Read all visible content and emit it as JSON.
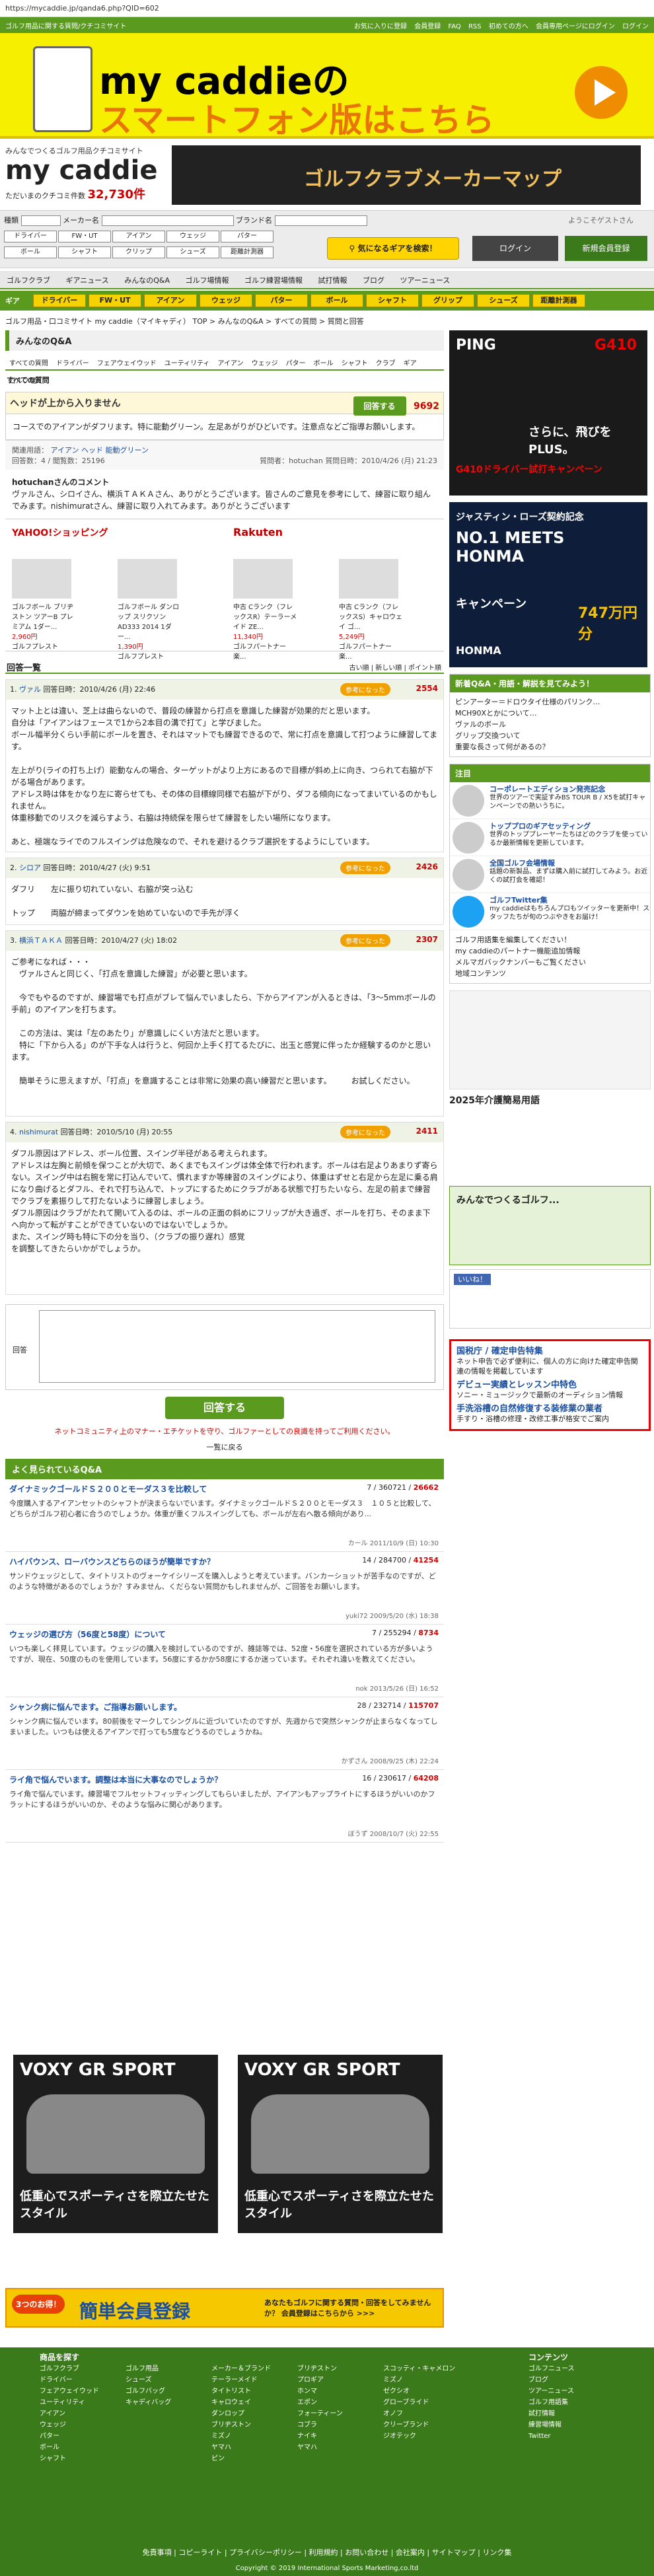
{
  "url": "https://mycaddie.jp/qanda6.php?QID=602",
  "top_strip": {
    "left": "ゴルフ用品に関する質問/クチコミサイト",
    "links": [
      "お気に入りに登録",
      "会員登録",
      "FAQ",
      "RSS",
      "初めての方へ",
      "会員専用ページにログイン",
      "ログイン"
    ]
  },
  "sp_banner": {
    "line1": "my caddieの",
    "line2": "スマートフォン版はこちら"
  },
  "logo": {
    "tagline": "みんなでつくるゴルフ用品クチコミサイト",
    "name": "my caddie",
    "count_label": "ただいまのクチコミ件数",
    "count": "32,730件"
  },
  "maker_banner": "ゴルフクラブメーカーマップ",
  "search": {
    "kind_label": "種類",
    "maker_label": "メーカー名",
    "brand_label": "ブランド名",
    "cats1": [
      "ドライバー",
      "FW・UT",
      "アイアン",
      "ウェッジ",
      "パター"
    ],
    "cats2": [
      "ボール",
      "シャフト",
      "クリップ",
      "シューズ",
      "距離計測器"
    ],
    "find_btn": "気になるギアを検索！",
    "login": "ログイン",
    "register": "新規会員登録",
    "welcome": "ようこそゲストさん"
  },
  "gnav": [
    "ゴルフクラブ",
    "ギアニュース",
    "みんなのQ&A",
    "ゴルフ場情報",
    "ゴルフ練習場情報",
    "試打情報",
    "ブログ",
    "ツアーニュース"
  ],
  "gear_nav": [
    "ギア",
    "ドライバー",
    "FW・UT",
    "アイアン",
    "ウェッジ",
    "パター",
    "ボール",
    "シャフト",
    "グリップ",
    "シューズ",
    "距離計測器"
  ],
  "breadcrumb": "ゴルフ用品・口コミサイト my caddie（マイキャディ） TOP > みんなのQ&A > すべての質問 > 質問と回答",
  "section_title": "みんなのQ&A",
  "tabs": [
    "すべての質問",
    "ドライバー",
    "フェアウェイウッド",
    "ユーティリティ",
    "アイアン",
    "ウェッジ",
    "パター",
    "ボール",
    "シャフト",
    "クラブ",
    "ギア",
    "ゴルフ場"
  ],
  "all_questions": "すべての質問",
  "question": {
    "title": "ヘッドが上から入りません",
    "answer_btn": "回答する",
    "score": "9692",
    "body": "コースでのアイアンがダフリます。特に能動グリーン。左足あがりがひどいです。注意点などご指導お願いします。",
    "genre_label": "関連用語：",
    "genres": [
      "アイアン",
      "ヘッド",
      "能動グリーン"
    ],
    "answers_label": "回答数：4",
    "views": "閲覧数：25196",
    "asker": "質問者：hotuchan",
    "date": "質問日時：2010/4/26 (月) 21:23"
  },
  "comment": {
    "title": "hotuchanさんのコメント",
    "body": "ヴァルさん、シロイさん、横浜ＴＡＫＡさん、ありがとうございます。皆さんのご意見を参考にして、練習に取り組んでみます。nishimuratさん、練習に取り入れてみます。ありがとうございます"
  },
  "shops": [
    {
      "shop": "YAHOO!ショッピング",
      "items": [
        {
          "name": "ゴルフボール ブリヂストン ツアーB プレミアム 1ダー...",
          "price": "2,960円",
          "store": "ゴルフプレスト"
        },
        {
          "name": "ゴルフボール ダンロップ スリクソン AD333 2014 1ダー...",
          "price": "1,390円",
          "store": "ゴルフプレスト"
        }
      ]
    },
    {
      "shop": "Rakuten",
      "items": [
        {
          "name": "中古 Cランク（フレックスR）テーラーメイド ZE...",
          "price": "11,340円",
          "store": "ゴルフパートナー 楽..."
        },
        {
          "name": "中古 Cランク（フレックスS）キャロウェイ ゴ...",
          "price": "5,249円",
          "store": "ゴルフパートナー 楽..."
        }
      ]
    }
  ],
  "answers_title": "回答一覧",
  "sort": "古い順 | 新しい順 | ポイント順",
  "answers": [
    {
      "num": "1.",
      "user": "ヴァル",
      "date": "回答日時：2010/4/26 (月) 22:46",
      "good": "参考になった",
      "score": "2554",
      "body": "マット上とは違い、芝上は曲らないので、普段の練習から打点を意識した練習が効果的だと思います。\n自分は「アイアンはフェースで1から2本目の溝で打て」と学びました。\nボール幅半分くらい手前にボールを置き、それはマットでも練習できるので、常に打点を意識して打つように練習してます。\n\n左上がり(ライの打ち上げ）能動なんの場合、ターゲットがより上方にあるので目標が斜め上に向き、つられて右脇が下がる場合があります。\nアドレス時は体をかなり左に寄らせても、その体の目標線同様で右脇が下がり、ダフる傾向になってまいているのかもしれません。\n体重移動でのリスクを減らすよう、右脇は持続保を限らせて練習をしたい場所になります。\n\nあと、極端なライでのフルスイングは危険なので、それを避けるクラブ選択をするようにしています。"
    },
    {
      "num": "2.",
      "user": "シロア",
      "date": "回答日時：2010/4/27 (火) 9:51",
      "good": "参考になった",
      "score": "2426",
      "body": "ダフリ　　左に振り切れていない、右脇が突っ込む\n\nトップ　　両脇が締まってダウンを始めていないので手先が浮く"
    },
    {
      "num": "3.",
      "user": "横浜ＴＡＫＡ",
      "date": "回答日時：2010/4/27 (火) 18:02",
      "good": "参考になった",
      "score": "2307",
      "body": "ご参考になれば・・・\n　ヴァルさんと同じく、「打点を意識した練習」が必要と思います。\n\n　今でもやるのですが、練習場でも打点がブレて悩んでいましたら、下からアイアンが入るときは、「3～5mmボールの手前」のアイアンを打ちます。\n\n　この方法は、実は「左のあたり」が意識しにくい方法だと思います。\n　特に「下から入る」のが下手な人は行うと、何回か上手く打てるたびに、出玉と感覚に伴ったか経験するのかと思います。\n\n　簡単そうに思えますが、「打点」を意識することは非常に効果の高い練習だと思います。　　　お試しください。"
    },
    {
      "num": "4.",
      "user": "nishimurat",
      "date": "回答日時：2010/5/10 (月) 20:55",
      "good": "参考になった",
      "score": "2411",
      "body": "ダフル原因はアドレス、ボール位置、スイング半径がある考えられます。\nアドレスは左胸と前傾を保つことが大切で、あくまでもスイングは体全体で行われます。ボールは右足よりあまりず寄らない。スイング中は右腕を常に打込んでいて、慣れますか等練習のスイングにより、体重はずせと右足から左足に乗る肩になり曲げるとダフル、それで打ち込んで、トップにするためにクラブがある状態で打ちたいなら、左足の前まで練習でクラブを素振りして打たないように練習しましょう。\nダフル原因はクラブがたれて開いて入るのは、ボールの正面の斜めにフリップが大き過ぎ、ボールを打ち、そのまま下へ向かって転がすことができていないのではないでしょうか。\nまた、スイング時も特に下の分を当り、（クラブの振り遅れ）感覚\nを調整してきたらいかがでしょうか。"
    }
  ],
  "reply": {
    "label": "回答",
    "submit": "回答する",
    "warn": "ネットコミュニティ上のマナー・エチケットを守り、ゴルファーとしての良識を持ってご利用ください。",
    "back": "一覧に戻る"
  },
  "related_title": "よく見られているQ&A",
  "related": [
    {
      "title": "ダイナミックゴールドＳ２００とモーダス３を比較して",
      "ans": "7",
      "views": "360721",
      "pts": "26662",
      "body": "今度購入するアイアンセットのシャフトが決まらないでいます。ダイナミックゴールドＳ２００とモーダス３　１０５と比較して、どちらがゴルフ初心者に合うのでしょうか。体重が重くフルスイングしても、ボールが左右へ散る傾向があり...",
      "foot": "カール 2011/10/9 (日) 10:30"
    },
    {
      "title": "ハイバウンス、ローバウンスどちらのほうが簡単ですか？",
      "ans": "14",
      "views": "284700",
      "pts": "41254",
      "body": "サンドウェッジとして、タイトリストのヴォーケイシリーズを購入しようと考えています。バンカーショットが苦手なのですが、どのような特徴があるのでしょうか？すみません、くだらない質問かもしれませんが、ご回答をお願いします。",
      "foot": "yuki72 2009/5/20 (水) 18:38"
    },
    {
      "title": "ウェッジの選び方（56度と58度）について",
      "ans": "7",
      "views": "255294",
      "pts": "8734",
      "body": "いつも楽しく拝見しています。ウェッジの購入を検討しているのですが、雑誌等では、52度・56度を選択されている方が多いようですが、現在、50度のものを使用しています。56度にするかか58度にするか迷っています。それぞれ違いを教えてください。",
      "foot": "nok 2013/5/26 (日) 16:52"
    },
    {
      "title": "シャンク病に悩んでます。ご指導お願いします。",
      "ans": "28",
      "views": "232714",
      "pts": "115707",
      "body": "シャンク病に悩んでいます。80前後をマークしてシングルに近づいていたのですが、先週からで突然シャンクが止まらなくなってしまいました。いつもは使えるアイアンで打っても5度などうるのでしょうかね。",
      "foot": "かずさん 2008/9/25 (木) 22:24"
    },
    {
      "title": "ライ角で悩んでいます。調整は本当に大事なのでしょうか？",
      "ans": "16",
      "views": "230617",
      "pts": "64208",
      "body": "ライ角で悩んでいます。練習場でフルセットフィッティングしてもらいましたが、アイアンもアップライトにするほうがいいのかフラットにするほうがいいのか、そのような悩みに関心があります。",
      "foot": "ぼうず 2008/10/7 (火) 22:55"
    }
  ],
  "toyota": {
    "name": "VOXY GR SPORT",
    "tag": "低重心でスポーティさを際立たせたスタイル"
  },
  "reg_banner": {
    "left": "3つのお得！",
    "main": "簡単会員登録",
    "right": "あなたもゴルフに関する質問・回答をしてみませんか？ 会員登録はこちらから >>>"
  },
  "side": {
    "ad1": {
      "brand": "PING",
      "product": "G410",
      "copy": "さらに、飛びをPLUS。",
      "sub": "G410ドライバー試打キャンペーン"
    },
    "ad2": {
      "title": "ジャスティン・ローズ契約記念",
      "big": "NO.1 MEETS HONMA",
      "campaign": "キャンペーン",
      "prize": "747万円分",
      "brand": "HONMA"
    },
    "news_title": "新着Q&A・用語・解説を見てみよう！",
    "news": [
      "ピンアーター＝ドロウタイ仕様のパリンク…",
      "MCH90Xとかについて…",
      "ヴァルのボール",
      "グリップ交換ついて",
      "重要な長さって何があるの？"
    ],
    "feature_title": "注目",
    "features": [
      {
        "t": "コーポレートエディション発売記念",
        "b": "世界のツアーで実証すみBS TOUR B / X5を試打キャンペーンでの熱いうちに。"
      },
      {
        "t": "トッププロのギアセッティング",
        "b": "世界のトッププレーヤーたちはどのクラブを使っているか最新情報を更新しています。"
      },
      {
        "t": "全国ゴルフ会場情報",
        "b": "話題の新製品、まずは購入前に試打してみよう。お近くの試打会を確認！"
      },
      {
        "t": "ゴルフTwitter集",
        "b": "my caddieはもちろんプロもツイッターを更新中！スタッフたちが旬のつぶやきをお届け！"
      }
    ],
    "sidelinks": [
      "ゴルフ用語集を編集してください！",
      "my caddieのパートナー機能追加情報",
      "メルマガバックナンバーもご覧ください",
      "地域コンテンツ"
    ],
    "lottery_title": "2025年介護簡易用語",
    "golf_banner": "みんなでつくるゴルフ...",
    "fb_like": "いいね！",
    "jobs": {
      "t1": "国税庁 / 確定申告特集",
      "b1": "ネット申告で必ず便利に、個人の方に向けた確定申告関連の情報を掲載しています",
      "t2": "デビュー実績とレッスン中特色",
      "b2": "ソニー・ミュージックで最新のオーディション情報",
      "t3": "手洗浴槽の自然修復する装修業の業者",
      "b3": "手すり・浴槽の修理・改修工事が格安でご案内"
    }
  },
  "footer": {
    "products_title": "商品を探す",
    "contents_title": "コンテンツ",
    "col1": [
      "ゴルフクラブ",
      "ドライバー",
      "フェアウェイウッド",
      "ユーティリティ",
      "アイアン",
      "ウェッジ",
      "パター",
      "ボール",
      "シャフト"
    ],
    "col2": [
      "ゴルフ用品",
      "シューズ",
      "ゴルフバッグ",
      "キャディバッグ"
    ],
    "col3": [
      "メーカー＆ブランド",
      "テーラーメイド",
      "タイトリスト",
      "キャロウェイ",
      "ダンロップ",
      "ブリヂストン",
      "ミズノ",
      "ヤマハ",
      "ピン"
    ],
    "col4": [
      "ブリヂストン",
      "プロギア",
      "ホンマ",
      "エポン",
      "フォーティーン",
      "コブラ",
      "ナイキ",
      "ヤマハ"
    ],
    "col5": [
      "スコッティ・キャメロン",
      "ミズノ",
      "ゼクシオ",
      "グローブライド",
      "オノフ",
      "クリーブランド",
      "ジオテック"
    ],
    "col6": [
      "ゴルフニュース",
      "ブログ",
      "ツアーニュース",
      "ゴルフ用語集",
      "試打情報",
      "練習場情報",
      "Twitter"
    ],
    "links": "免責事項 | コピーライト | プライバシーポリシー | 利用規約 | お問い合わせ | 会社案内 | サイトマップ | リンク集",
    "copyright": "Copyright © 2019 International Sports Marketing,co.ltd"
  }
}
